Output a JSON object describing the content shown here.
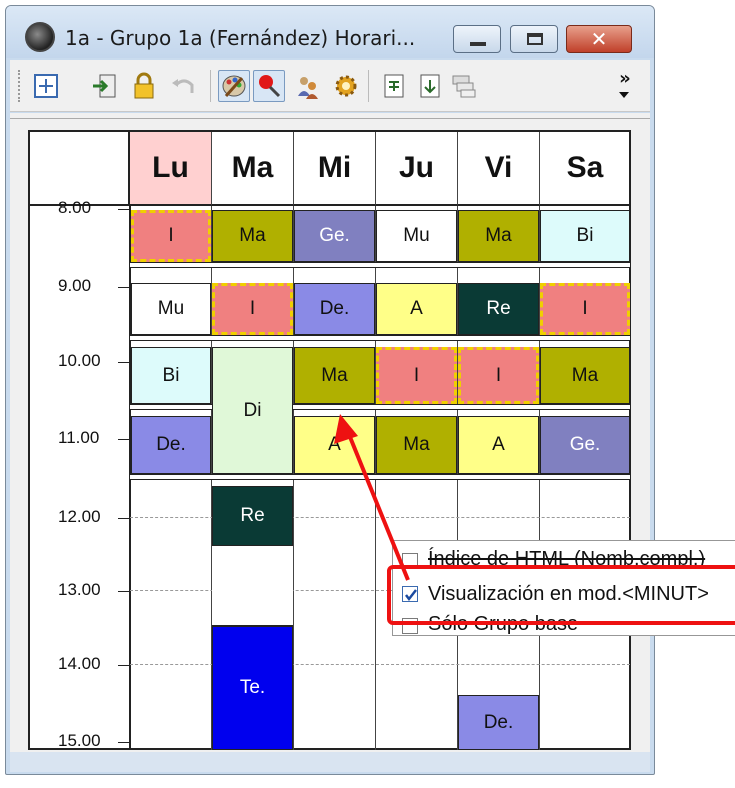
{
  "window": {
    "title": "1a - Grupo 1a (Fernández)  Horari..."
  },
  "toolbar": {
    "icons": [
      "grid-settings-icon",
      "export-icon",
      "lock-icon",
      "undo-icon",
      "palette-icon",
      "pin-icon",
      "people-icon",
      "gear-icon",
      "print-icon",
      "export-page-icon",
      "stack-icon",
      "more-icon"
    ],
    "overflow_glyph": "»"
  },
  "days": [
    "Lu",
    "Ma",
    "Mi",
    "Ju",
    "Vi",
    "Sa"
  ],
  "times": [
    "8.00",
    "9.00",
    "10.00",
    "11.00",
    "12.00",
    "13.00",
    "14.00",
    "15.00"
  ],
  "lessons": {
    "lu": [
      "I",
      "Mu",
      "Bi",
      "De."
    ],
    "ma": [
      "Ma",
      "I",
      "Di",
      "Re",
      "Te."
    ],
    "mi": [
      "Ge.",
      "De.",
      "Ma",
      "A"
    ],
    "ju": [
      "Mu",
      "A",
      "I",
      "Ma"
    ],
    "vi": [
      "Ma",
      "Re",
      "I",
      "A",
      "De."
    ],
    "sa": [
      "Bi",
      "I",
      "Ma",
      "Ge."
    ]
  },
  "context_menu": {
    "items": [
      {
        "label": "Índice de HTML (Nomb.compl.)",
        "checked": false
      },
      {
        "label": "Visualización en mod.<MINUT>",
        "checked": true
      },
      {
        "label": "Sólo Grupo base",
        "checked": false
      }
    ]
  },
  "colors": {
    "accent_highlight": "#ee1111",
    "lu_header": "#ffd0d0",
    "hatch_block": "#f08080",
    "olive": "#b0b000",
    "slate": "#8080c0",
    "periwinkle": "#8a8ae6",
    "dark_green": "#0a3a35",
    "light_cyan": "#ddfbfb",
    "yellow": "#ffff88",
    "light_green": "#e0f8d8",
    "blue": "#0000ee"
  }
}
